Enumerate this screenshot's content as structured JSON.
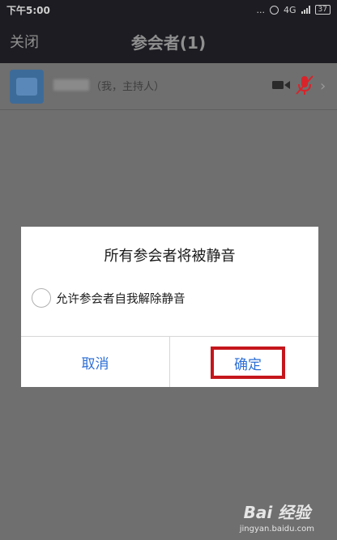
{
  "status_bar": {
    "time": "下午5:00",
    "dots": "...",
    "network": "4G",
    "battery": "37"
  },
  "nav": {
    "close_label": "关闭",
    "title": "参会者(1)"
  },
  "participant": {
    "name_suffix": "（我，主持人）"
  },
  "dialog": {
    "title": "所有参会者将被静音",
    "option_label": "允许参会者自我解除静音",
    "option_checked": false,
    "cancel_label": "取消",
    "confirm_label": "确定"
  },
  "watermark": {
    "main": "Bai 经验",
    "sub": "jingyan.baidu.com"
  },
  "colors": {
    "accent": "#2d6fd6",
    "highlight_box": "#c5161c",
    "mic_muted": "#d9232a"
  }
}
